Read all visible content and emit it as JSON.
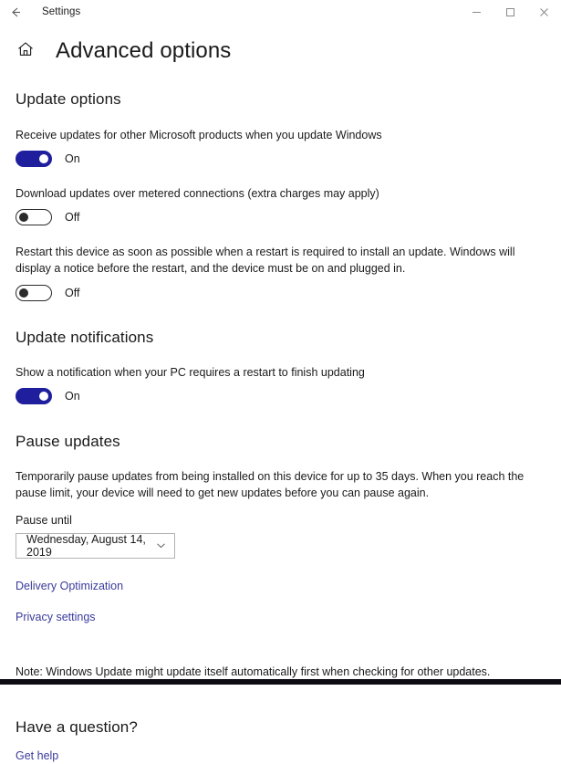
{
  "titlebar": {
    "back_label": "Back",
    "app_title": "Settings",
    "minimize_label": "Minimize",
    "maximize_label": "Maximize",
    "close_label": "Close"
  },
  "header": {
    "home_label": "Home",
    "page_title": "Advanced options"
  },
  "update_options": {
    "heading": "Update options",
    "items": [
      {
        "description": "Receive updates for other Microsoft products when you update Windows",
        "state": "On"
      },
      {
        "description": "Download updates over metered connections (extra charges may apply)",
        "state": "Off"
      },
      {
        "description": "Restart this device as soon as possible when a restart is required to install an update. Windows will display a notice before the restart, and the device must be on and plugged in.",
        "state": "Off"
      }
    ]
  },
  "update_notifications": {
    "heading": "Update notifications",
    "items": [
      {
        "description": "Show a notification when your PC requires a restart to finish updating",
        "state": "On"
      }
    ]
  },
  "pause_updates": {
    "heading": "Pause updates",
    "description": "Temporarily pause updates from being installed on this device for up to 35 days. When you reach the pause limit, your device will need to get new updates before you can pause again.",
    "field_label": "Pause until",
    "selected_date": "Wednesday, August 14, 2019"
  },
  "links": [
    {
      "label": "Delivery Optimization"
    },
    {
      "label": "Privacy settings"
    }
  ],
  "note": "Note: Windows Update might update itself automatically first when checking for other updates.",
  "help": {
    "heading": "Have a question?",
    "link_label": "Get help"
  },
  "colors": {
    "accent": "#1f1f9e",
    "link": "#3b3b9e",
    "text": "#1a1a1a",
    "border": "#b3b3b3"
  }
}
